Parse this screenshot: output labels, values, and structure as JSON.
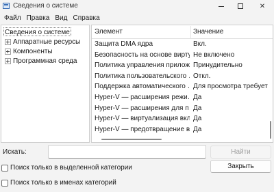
{
  "window": {
    "title": "Сведения о системе",
    "controls": {
      "minimize": "minimize",
      "maximize": "maximize",
      "close": "✕"
    }
  },
  "menu": [
    "Файл",
    "Правка",
    "Вид",
    "Справка"
  ],
  "tree": {
    "root": "Сведения о системе",
    "children": [
      "Аппаратные ресурсы",
      "Компоненты",
      "Программная среда"
    ]
  },
  "table": {
    "columns": [
      "Элемент",
      "Значение"
    ],
    "rows": [
      [
        "Защита DMA ядра",
        "Вкл."
      ],
      [
        "Безопасность на основе вирту…",
        "Не включено"
      ],
      [
        "Политика управления прилож…",
        "Принудительно"
      ],
      [
        "Политика пользовательского …",
        "Откл."
      ],
      [
        "Поддержка автоматического …",
        "Для просмотра требует"
      ],
      [
        "Hyper-V — расширения режи…",
        "Да"
      ],
      [
        "Hyper-V — расширения для п…",
        "Да"
      ],
      [
        "Hyper-V — виртуализация вкл…",
        "Да"
      ],
      [
        "Hyper-V — предотвращение в…",
        "Да"
      ]
    ]
  },
  "search": {
    "label": "Искать:",
    "value": "",
    "find_button": "Найти",
    "close_button": "Закрыть"
  },
  "options": {
    "selected_category_only": "Поиск только в выделенной категории",
    "category_names_only": "Поиск только в именах категорий"
  }
}
